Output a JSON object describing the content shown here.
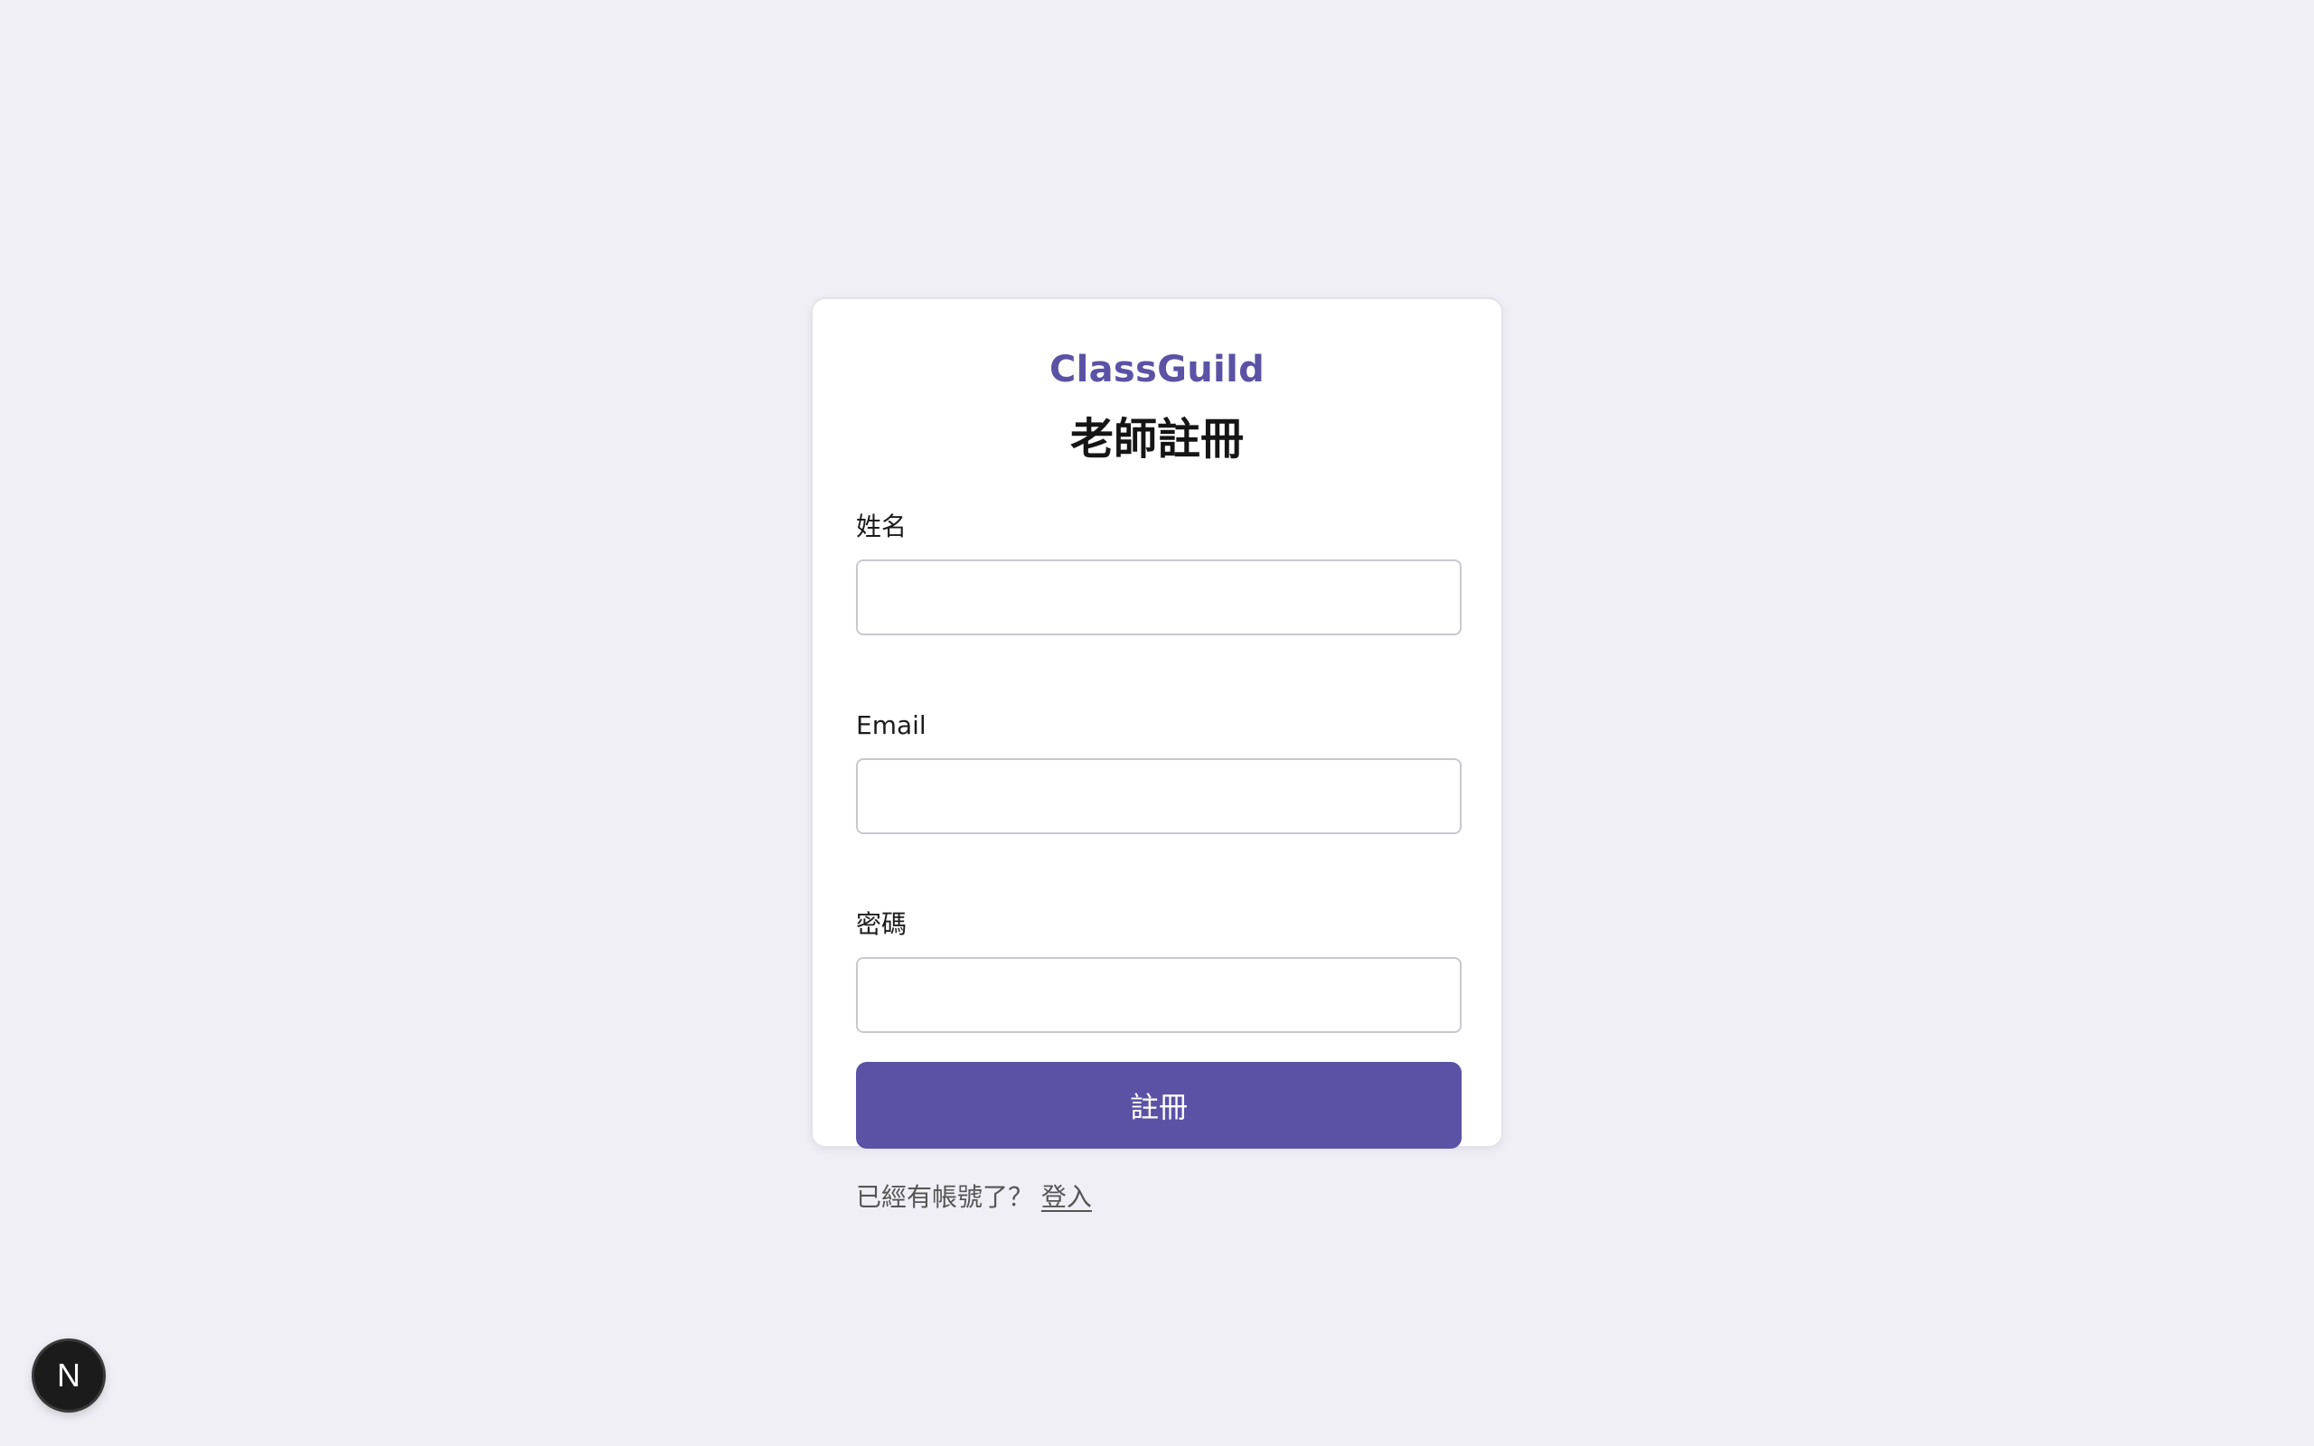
{
  "brand": "ClassGuild",
  "title": "老師註冊",
  "form": {
    "name_label": "姓名",
    "name_value": "",
    "email_label": "Email",
    "email_value": "",
    "password_label": "密碼",
    "password_value": "",
    "submit_label": "註冊"
  },
  "footer": {
    "prompt": "已經有帳號了？",
    "login_link": "登入"
  },
  "dev_badge": {
    "letter": "N",
    "icon": "nextjs-icon"
  },
  "colors": {
    "background": "#f0eff5",
    "brand": "#5b52a5",
    "button": "#5b52a6"
  }
}
